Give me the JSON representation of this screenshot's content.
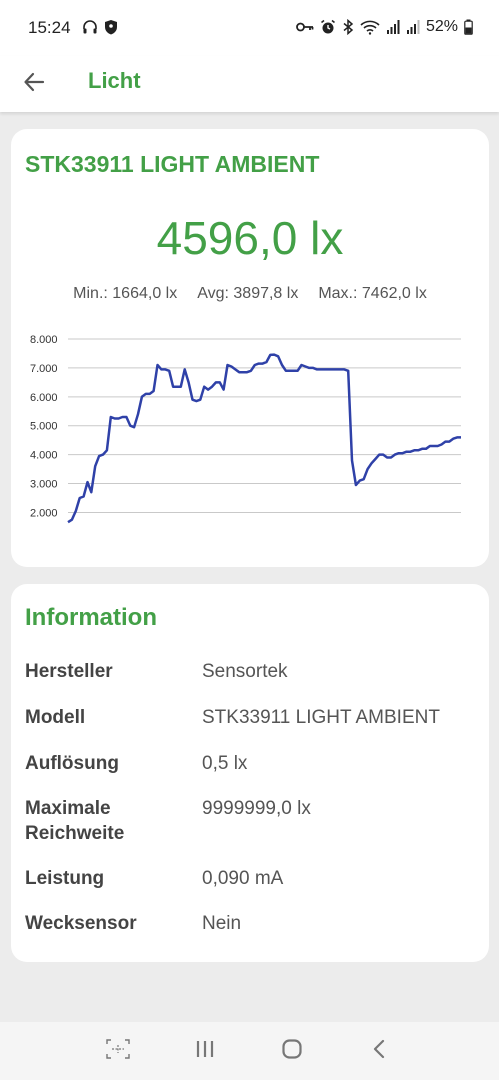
{
  "status_bar": {
    "time": "15:24",
    "battery": "52%",
    "left_icons": [
      "headphones-icon",
      "shield-icon"
    ],
    "right_icons": [
      "key-icon",
      "alarm-icon",
      "bluetooth-icon",
      "wifi-icon",
      "signal-icon",
      "signal-icon",
      "battery-icon"
    ]
  },
  "app_bar": {
    "title": "Licht",
    "back_icon": "arrow-left-icon"
  },
  "sensor": {
    "name": "STK33911 LIGHT AMBIENT",
    "current_value": "4596,0 lx",
    "min": "Min.: 1664,0 lx",
    "avg": "Avg: 3897,8 lx",
    "max": "Max.: 7462,0 lx"
  },
  "chart_data": {
    "type": "line",
    "ylim": [
      1600,
      8000
    ],
    "yticks": [
      2000,
      3000,
      4000,
      5000,
      6000,
      7000,
      8000
    ],
    "ytick_labels": [
      "2.000",
      "3.000",
      "4.000",
      "5.000",
      "6.000",
      "7.000",
      "8.000"
    ],
    "grid": true,
    "color": "#2f41a8",
    "series": [
      {
        "values": [
          1664,
          1750,
          2050,
          2500,
          2550,
          3050,
          2700,
          3600,
          3950,
          4000,
          4150,
          5300,
          5250,
          5250,
          5300,
          5300,
          5000,
          4950,
          5400,
          6000,
          6100,
          6100,
          6200,
          7100,
          6950,
          6950,
          6900,
          6350,
          6350,
          6350,
          6950,
          6500,
          5900,
          5850,
          5900,
          6350,
          6250,
          6350,
          6500,
          6500,
          6250,
          7100,
          7050,
          6950,
          6850,
          6850,
          6850,
          6900,
          7100,
          7150,
          7150,
          7200,
          7450,
          7462,
          7400,
          7100,
          6900,
          6900,
          6900,
          6900,
          7100,
          7050,
          7000,
          7000,
          6950,
          6950,
          6950,
          6950,
          6950,
          6950,
          6950,
          6950,
          6900,
          3800,
          2950,
          3100,
          3150,
          3500,
          3700,
          3850,
          4000,
          4000,
          3900,
          3900,
          4000,
          4050,
          4050,
          4100,
          4100,
          4150,
          4150,
          4200,
          4200,
          4300,
          4300,
          4300,
          4350,
          4450,
          4450,
          4550,
          4596,
          4596
        ]
      }
    ]
  },
  "information": {
    "title": "Information",
    "rows": [
      {
        "label": "Hersteller",
        "value": "Sensortek"
      },
      {
        "label": "Modell",
        "value": "STK33911 LIGHT AMBIENT"
      },
      {
        "label": "Auflösung",
        "value": "0,5 lx"
      },
      {
        "label": "Maximale Reichweite",
        "value": "9999999,0 lx"
      },
      {
        "label": "Leistung",
        "value": "0,090 mA"
      },
      {
        "label": "Wecksensor",
        "value": "Nein"
      }
    ]
  },
  "nav_bar": {
    "icons": [
      "screenshot-scan-icon",
      "recent-apps-icon",
      "home-icon",
      "back-chevron-icon"
    ]
  },
  "colors": {
    "accent": "#43a047",
    "chart_line": "#2f41a8",
    "background": "#ececec",
    "card": "#ffffff"
  }
}
